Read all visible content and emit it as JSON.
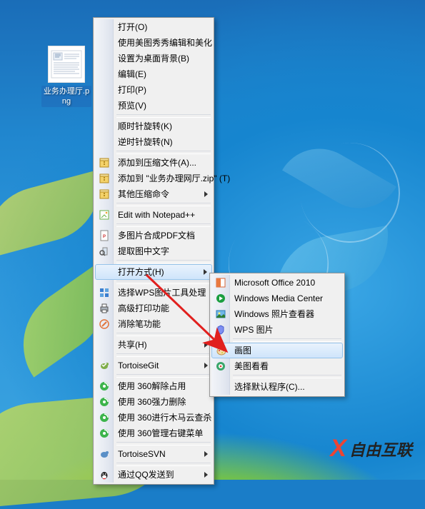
{
  "desktop": {
    "file": {
      "label": "业务办理厅.png"
    }
  },
  "context_menu": {
    "items": [
      {
        "label": "打开(O)"
      },
      {
        "label": "使用美图秀秀编辑和美化"
      },
      {
        "label": "设置为桌面背景(B)"
      },
      {
        "label": "编辑(E)"
      },
      {
        "label": "打印(P)"
      },
      {
        "label": "预览(V)"
      },
      {
        "sep": true
      },
      {
        "label": "顺时针旋转(K)"
      },
      {
        "label": "逆时针旋转(N)"
      },
      {
        "sep": true
      },
      {
        "label": "添加到压缩文件(A)...",
        "icon": "archive-icon"
      },
      {
        "label": "添加到 \"业务办理网厅.zip\" (T)",
        "icon": "archive-icon"
      },
      {
        "label": "其他压缩命令",
        "icon": "archive-icon",
        "submenu": true
      },
      {
        "sep": true
      },
      {
        "label": "Edit with Notepad++",
        "icon": "notepad-icon"
      },
      {
        "sep": true
      },
      {
        "label": "多图片合成PDF文档",
        "icon": "pdf-icon"
      },
      {
        "label": "提取图中文字",
        "icon": "ocr-icon"
      },
      {
        "sep": true
      },
      {
        "label": "打开方式(H)",
        "submenu": true,
        "hover": true
      },
      {
        "sep": true
      },
      {
        "label": "选择WPS图片工具处理",
        "icon": "wps-grid-icon"
      },
      {
        "label": "高级打印功能",
        "icon": "print-icon"
      },
      {
        "label": "消除笔功能",
        "icon": "pen-icon"
      },
      {
        "sep": true
      },
      {
        "label": "共享(H)",
        "submenu": true
      },
      {
        "sep": true
      },
      {
        "label": "TortoiseGit",
        "icon": "tortoise-icon",
        "submenu": true
      },
      {
        "sep": true
      },
      {
        "label": "使用 360解除占用",
        "icon": "360-icon"
      },
      {
        "label": "使用 360强力删除",
        "icon": "360-icon"
      },
      {
        "label": "使用 360进行木马云查杀",
        "icon": "360-icon"
      },
      {
        "label": "使用 360管理右键菜单",
        "icon": "360-icon"
      },
      {
        "sep": true
      },
      {
        "label": "TortoiseSVN",
        "icon": "tortoise-svn-icon",
        "submenu": true
      },
      {
        "sep": true
      },
      {
        "label": "通过QQ发送到",
        "icon": "qq-icon",
        "submenu": true
      }
    ]
  },
  "openwith_submenu": {
    "items": [
      {
        "label": "Microsoft Office 2010",
        "icon": "office-icon"
      },
      {
        "label": "Windows Media Center",
        "icon": "wmc-icon"
      },
      {
        "label": "Windows 照片查看器",
        "icon": "photo-viewer-icon"
      },
      {
        "label": "WPS 图片",
        "icon": "wps-icon"
      },
      {
        "sep": true
      },
      {
        "label": "画图",
        "icon": "paint-icon",
        "hover": true
      },
      {
        "label": "美图看看",
        "icon": "meitu-icon"
      },
      {
        "sep": true
      },
      {
        "label": "选择默认程序(C)..."
      }
    ]
  },
  "watermark": {
    "brand": "自由互联"
  }
}
